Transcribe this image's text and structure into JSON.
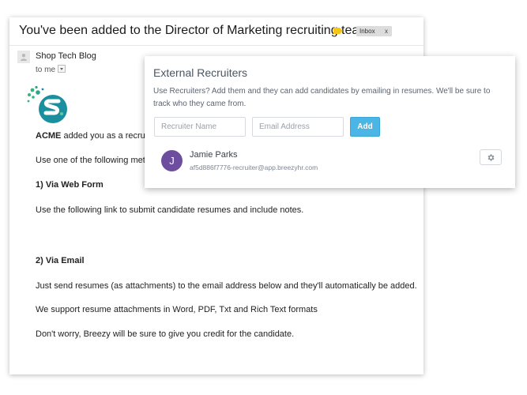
{
  "email": {
    "subject": "You've been added to the Director of Marketing recruiting team.",
    "label_chip": "Inbox",
    "label_chip_close": "x",
    "sender": "Shop Tech Blog",
    "recipient": "to me",
    "body": {
      "intro_bold": "ACME",
      "intro_rest": " added you as a recru",
      "methods_line": "Use one of the following meth",
      "via_web_form_heading": "1) Via Web Form",
      "web_form_text": "Use the following link to submit candidate resumes and include notes.",
      "via_email_heading": "2) Via Email",
      "email_text": "Just send resumes (as attachments) to the email address below and they'll automatically be added.",
      "formats_text": "We support resume attachments in Word, PDF, Txt and Rich Text formats",
      "credit_text": "Don't worry, Breezy will be sure to give you credit for the candidate."
    }
  },
  "modal": {
    "title": "External Recruiters",
    "description": "Use Recruiters? Add them and they can add candidates by emailing in resumes. We'll be sure to track who they came from.",
    "recruiter_name_placeholder": "Recruiter Name",
    "email_placeholder": "Email Address",
    "add_label": "Add",
    "recruiter": {
      "initial": "J",
      "name": "Jamie Parks",
      "email": "af5d886f7776-recruiter@app.breezyhr.com"
    }
  },
  "icons": {
    "label_tag": "label-tag-icon",
    "sender_avatar": "person-icon",
    "dropdown": "chevron-down-icon",
    "logo": "brand-logo-s",
    "settings": "gear-icon"
  },
  "colors": {
    "label_tag": "#f5c518",
    "add_button": "#4bb6e6",
    "recruiter_avatar": "#6d4d9e",
    "logo_teal": "#1a8fa0",
    "logo_green": "#37b37e"
  }
}
